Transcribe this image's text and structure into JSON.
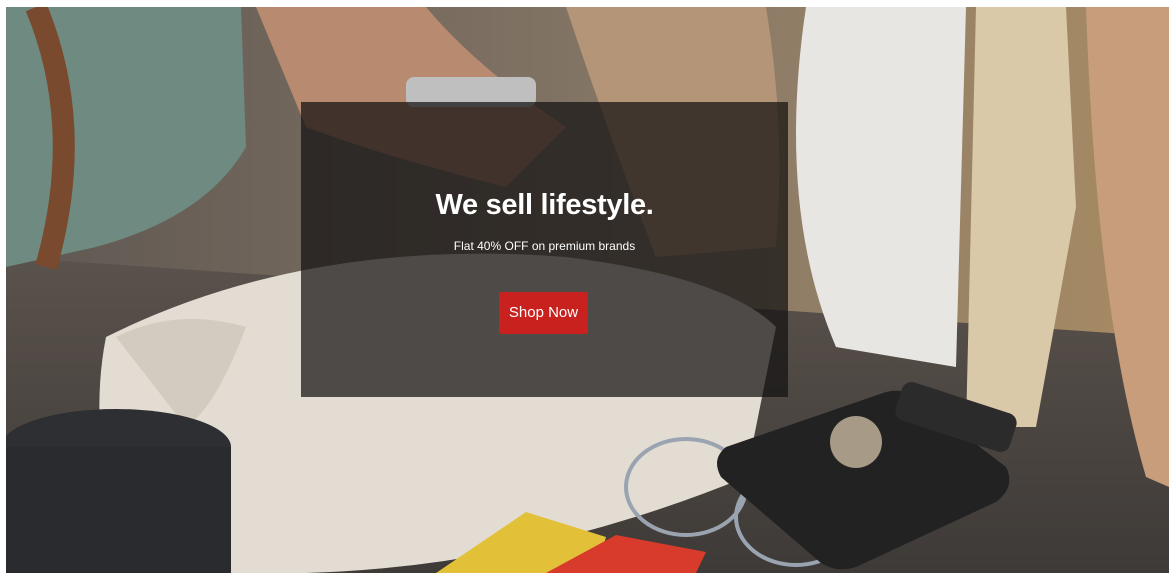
{
  "hero": {
    "headline": "We sell lifestyle.",
    "subheadline": "Flat 40% OFF on premium brands",
    "cta_label": "Shop Now",
    "cta_color": "#c8211e",
    "overlay_color": "#141212"
  }
}
